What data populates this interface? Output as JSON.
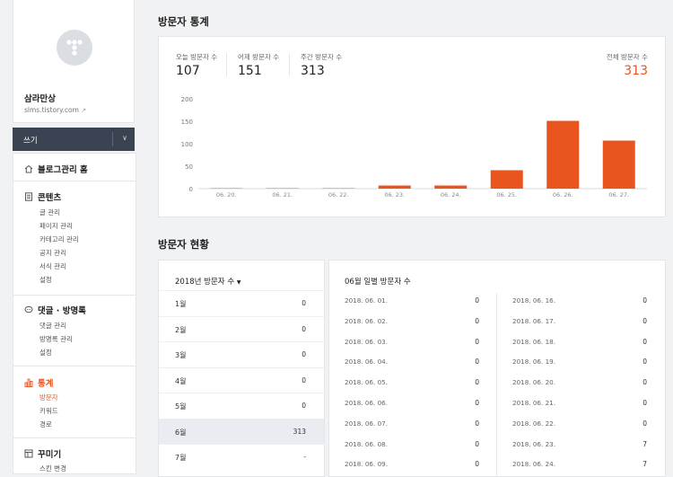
{
  "sidebar": {
    "blog_name": "삼라만상",
    "blog_url": "slms.tistory.com",
    "write_label": "쓰기",
    "home": "블로그관리 홈",
    "content": {
      "title": "콘텐츠",
      "items": [
        "글 관리",
        "페이지 관리",
        "카테고리 관리",
        "공지 관리",
        "서식 관리",
        "설정"
      ]
    },
    "comments": {
      "title": "댓글 · 방명록",
      "items": [
        "댓글 관리",
        "방명록 관리",
        "설정"
      ]
    },
    "stats": {
      "title": "통계",
      "items": [
        "방문자",
        "키워드",
        "경로"
      ]
    },
    "deco": {
      "title": "꾸미기",
      "items": [
        "스킨 변경"
      ]
    }
  },
  "visitor_stats": {
    "title": "방문자 통계",
    "today_label": "오늘 방문자 수",
    "today_value": "107",
    "yesterday_label": "어제 방문자 수",
    "yesterday_value": "151",
    "week_label": "주간 방문자 수",
    "week_value": "313",
    "total_label": "전체 방문자 수",
    "total_value": "313"
  },
  "chart_data": {
    "type": "bar",
    "categories": [
      "06. 20.",
      "06. 21.",
      "06. 22.",
      "06. 23.",
      "06. 24.",
      "06. 25.",
      "06. 26.",
      "06. 27."
    ],
    "values": [
      0,
      0,
      0,
      7,
      7,
      41,
      151,
      107
    ],
    "ylim": [
      0,
      200
    ],
    "yticks": [
      0,
      50,
      100,
      150,
      200
    ],
    "bar_color": "#e9541f",
    "title": "",
    "xlabel": "",
    "ylabel": ""
  },
  "visitor_status": {
    "title": "방문자 현황",
    "year_dropdown": "2018년 방문자 수",
    "months": [
      {
        "label": "1월",
        "value": "0"
      },
      {
        "label": "2월",
        "value": "0"
      },
      {
        "label": "3월",
        "value": "0"
      },
      {
        "label": "4월",
        "value": "0"
      },
      {
        "label": "5월",
        "value": "0"
      },
      {
        "label": "6월",
        "value": "313"
      },
      {
        "label": "7월",
        "value": "-"
      }
    ],
    "daily_title": "06월 일별 방문자 수",
    "daily_left": [
      {
        "date": "2018. 06. 01.",
        "count": "0"
      },
      {
        "date": "2018. 06. 02.",
        "count": "0"
      },
      {
        "date": "2018. 06. 03.",
        "count": "0"
      },
      {
        "date": "2018. 06. 04.",
        "count": "0"
      },
      {
        "date": "2018. 06. 05.",
        "count": "0"
      },
      {
        "date": "2018. 06. 06.",
        "count": "0"
      },
      {
        "date": "2018. 06. 07.",
        "count": "0"
      },
      {
        "date": "2018. 06. 08.",
        "count": "0"
      },
      {
        "date": "2018. 06. 09.",
        "count": "0"
      }
    ],
    "daily_right": [
      {
        "date": "2018. 06. 16.",
        "count": "0"
      },
      {
        "date": "2018. 06. 17.",
        "count": "0"
      },
      {
        "date": "2018. 06. 18.",
        "count": "0"
      },
      {
        "date": "2018. 06. 19.",
        "count": "0"
      },
      {
        "date": "2018. 06. 20.",
        "count": "0"
      },
      {
        "date": "2018. 06. 21.",
        "count": "0"
      },
      {
        "date": "2018. 06. 22.",
        "count": "0"
      },
      {
        "date": "2018. 06. 23.",
        "count": "7"
      },
      {
        "date": "2018. 06. 24.",
        "count": "7"
      }
    ]
  }
}
